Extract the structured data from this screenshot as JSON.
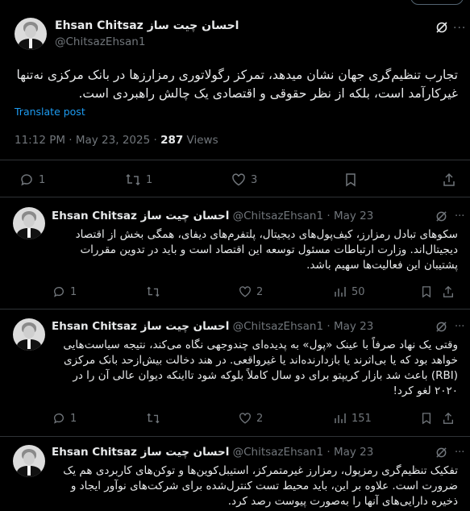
{
  "main_tweet": {
    "author_name": "Ehsan Chitsaz احسان چیت ساز",
    "handle": "@ChitsazEhsan1",
    "text": "تجارب تنظیم‌گری جهان نشان میدهد، تمرکز رگولاتوری رمزارزها در بانک مرکزی نه‌تنها غیرکارآمد است، بلکه از نظر حقوقی و اقتصادی یک چالش راهبردی است.",
    "translate": "Translate post",
    "time": "11:12 PM · May 23, 2025 · ",
    "views_count": "287",
    "views_label": " Views",
    "replies": "1",
    "reposts": "1",
    "likes": "3"
  },
  "replies": [
    {
      "author_name": "Ehsan Chitsaz احسان چیت ساز",
      "handle": "@ChitsazEhsan1",
      "date": "May 23",
      "text": "سکوهای تبادل رمزارز، کیف‌پول‌های دیجیتال، پلتفرم‌های دیفای، همگی بخش از اقتصاد دیجیتال‌اند. وزارت ارتباطات مسئول توسعه این اقتصاد است و باید در تدوین مقررات پشتیبان این فعالیت‌ها سهیم باشد.",
      "replies": "1",
      "likes": "2",
      "views": "50"
    },
    {
      "author_name": "Ehsan Chitsaz احسان چیت ساز",
      "handle": "@ChitsazEhsan1",
      "date": "May 23",
      "text": "وقتی یک نهاد صرفاً با عینک «پول» به پدیده‌ای چندوجهی نگاه می‌کند، نتیجه سیاست‌هایی خواهد بود که یا بی‌اثرند یا بازدارنده‌اند یا غیرواقعی. در هند دخالت بیش‌ازحد بانک مرکزی (RBI) باعث شد بازار کریپتو برای دو سال کاملاً بلوکه شود تااینکه دیوان عالی آن را در ۲۰۲۰ لغو کرد!",
      "replies": "1",
      "likes": "2",
      "views": "151"
    },
    {
      "author_name": "Ehsan Chitsaz احسان چیت ساز",
      "handle": "@ChitsazEhsan1",
      "date": "May 23",
      "text": "تفکیک تنظیم‌گری رمزپول، رمزارز غیرمتمرکز، استیبل‌کوین‌ها و توکن‌های کاربردی هم یک ضرورت است. علاوه بر این، باید محیط تست کنترل‌شده برای شرکت‌های نوآور ایجاد و ذخیره دارایی‌های آنها را به‌صورت پیوست رصد کرد."
    }
  ],
  "colors": {
    "background": "#000000",
    "text": "#e7e9ea",
    "muted": "#71767b",
    "link": "#1d9bf0",
    "divider": "#2f3336"
  }
}
